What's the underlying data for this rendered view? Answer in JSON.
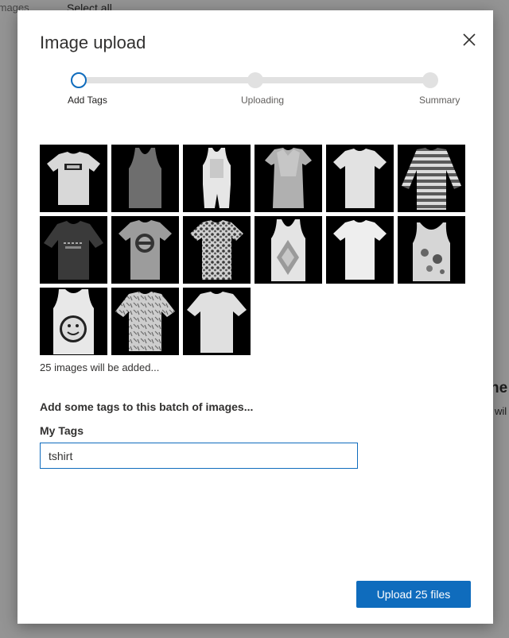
{
  "background": {
    "images_partial": "Images",
    "select_all": "Select all",
    "heading_partial": "ne",
    "sub_partial": "wil"
  },
  "dialog": {
    "title": "Image upload",
    "close_icon": "close-icon"
  },
  "stepper": {
    "current_step": 1,
    "steps": [
      {
        "label": "Add Tags"
      },
      {
        "label": "Uploading"
      },
      {
        "label": "Summary"
      }
    ]
  },
  "images": [
    {
      "name": "tshirt-logo"
    },
    {
      "name": "tank-top-dark"
    },
    {
      "name": "sleeveless-dress"
    },
    {
      "name": "dress"
    },
    {
      "name": "tshirt-plain"
    },
    {
      "name": "striped-top"
    },
    {
      "name": "dark-print-tshirt"
    },
    {
      "name": "tshirt-circle-print"
    },
    {
      "name": "patterned-tshirt"
    },
    {
      "name": "tank-diamond-print"
    },
    {
      "name": "tshirt-white"
    },
    {
      "name": "floral-camisole"
    },
    {
      "name": "tank-smiley"
    },
    {
      "name": "printed-tshirt"
    },
    {
      "name": "tshirt-light"
    }
  ],
  "count_text": "25 images will be added...",
  "tags": {
    "heading": "Add some tags to this batch of images...",
    "label": "My Tags",
    "value": "tshirt"
  },
  "upload_button": "Upload 25 files",
  "colors": {
    "accent": "#0f6cbd",
    "track": "#e1e1e1"
  }
}
